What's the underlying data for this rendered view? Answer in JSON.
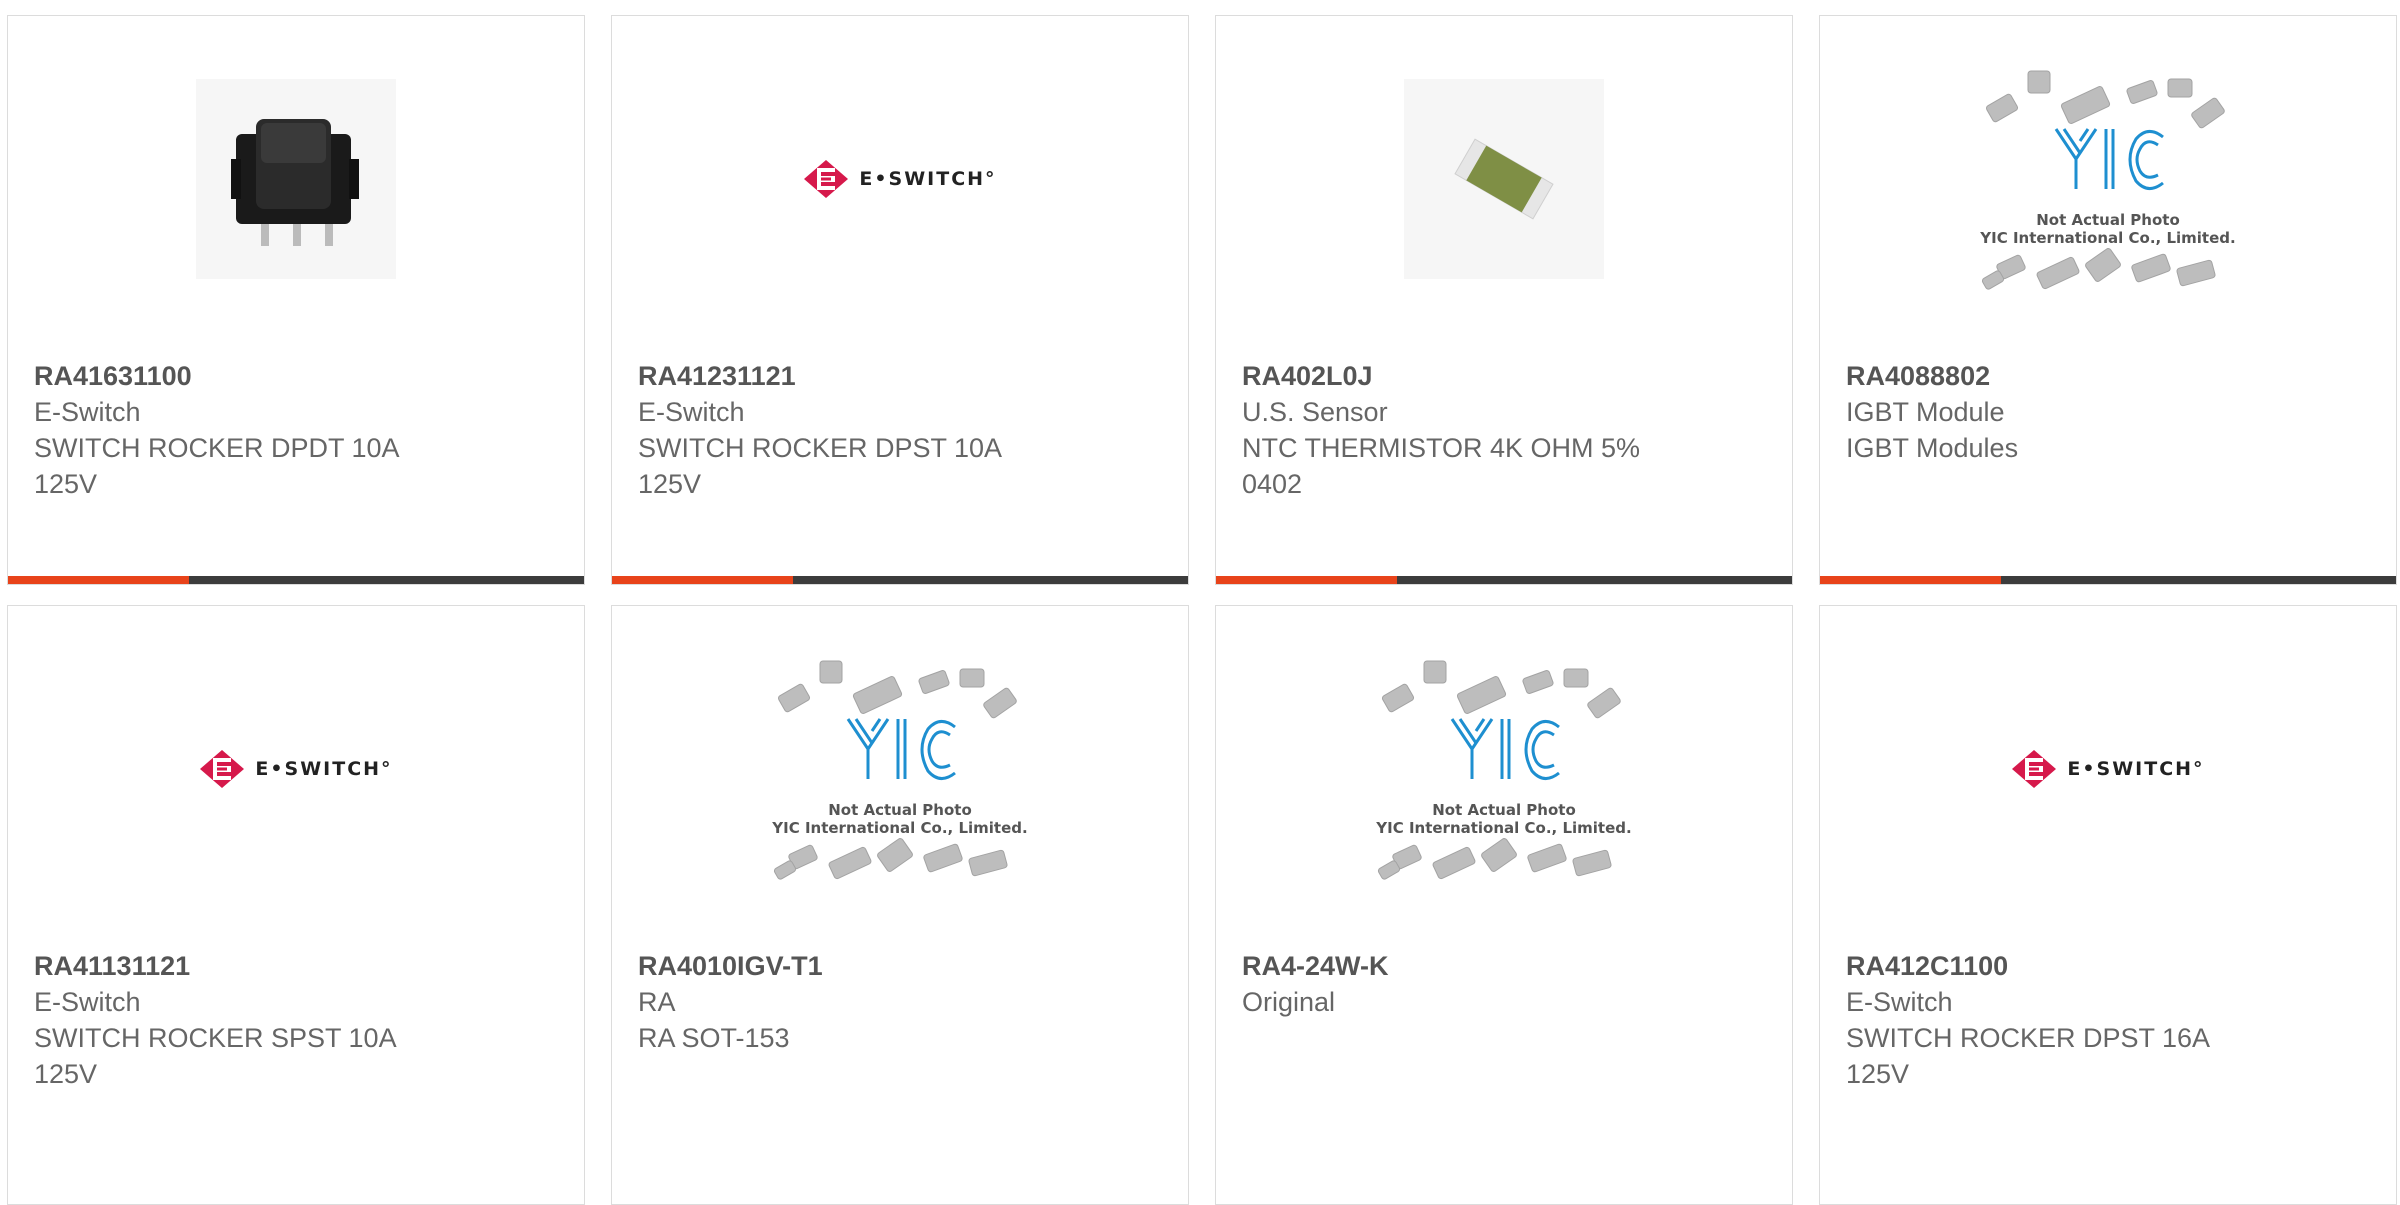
{
  "colors": {
    "accent": "#e8431a",
    "bar": "#3c3c3c",
    "border": "#dcdcdc",
    "text": "#666666",
    "eswitch_red": "#d6194b",
    "yic_blue": "#1e8fd0"
  },
  "products": [
    {
      "part_number": "RA41631100",
      "manufacturer": "E-Switch",
      "description": "SWITCH ROCKER DPDT 10A 125V",
      "image": "rocker-switch-photo"
    },
    {
      "part_number": "RA41231121",
      "manufacturer": "E-Switch",
      "description": "SWITCH ROCKER DPST 10A 125V",
      "image": "eswitch-logo"
    },
    {
      "part_number": "RA402L0J",
      "manufacturer": "U.S. Sensor",
      "description": "NTC THERMISTOR 4K OHM 5% 0402",
      "image": "thermistor-photo"
    },
    {
      "part_number": "RA4088802",
      "manufacturer": "IGBT Module",
      "description": "IGBT Modules",
      "image": "yic-placeholder"
    },
    {
      "part_number": "RA41131121",
      "manufacturer": "E-Switch",
      "description": "SWITCH ROCKER SPST 10A 125V",
      "image": "eswitch-logo"
    },
    {
      "part_number": "RA4010IGV-T1",
      "manufacturer": "RA",
      "description": "RA SOT-153",
      "image": "yic-placeholder"
    },
    {
      "part_number": "RA4-24W-K",
      "manufacturer": "Original",
      "description": "",
      "image": "yic-placeholder"
    },
    {
      "part_number": "RA412C1100",
      "manufacturer": "E-Switch",
      "description": "SWITCH ROCKER DPST 16A 125V",
      "image": "eswitch-logo"
    }
  ],
  "eswitch_logo_text": "E•SWITCH°",
  "yic_placeholder": {
    "logo_text": "YIC",
    "line1": "Not Actual Photo",
    "line2": "YIC International Co., Limited."
  },
  "progress_accent_fraction": 0.315
}
